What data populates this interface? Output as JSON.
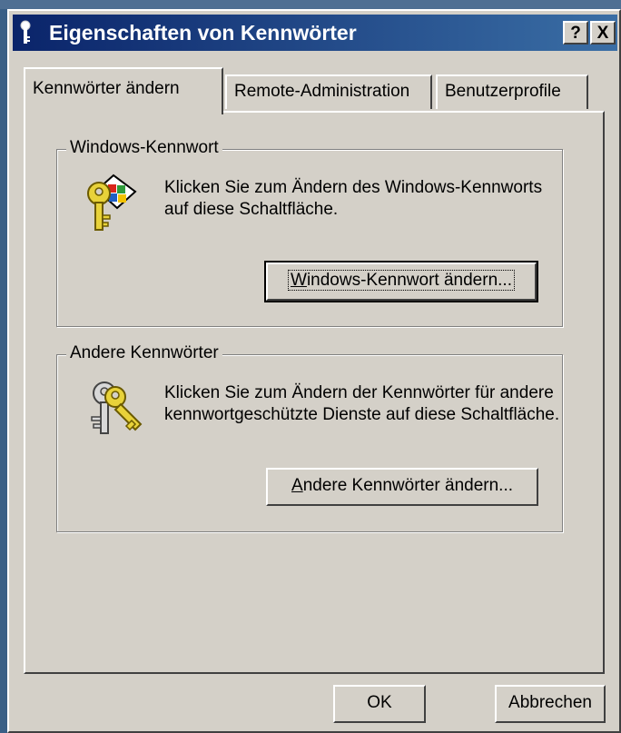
{
  "window": {
    "title": "Eigenschaften von Kennwörter",
    "help_label": "?",
    "close_label": "X"
  },
  "tabs": [
    {
      "label": "Kennwörter ändern",
      "active": true
    },
    {
      "label": "Remote-Administration",
      "active": false
    },
    {
      "label": "Benutzerprofile",
      "active": false
    }
  ],
  "windows_password": {
    "legend": "Windows-Kennwort",
    "description": "Klicken Sie zum Ändern des Windows-Kennworts auf diese Schaltfläche.",
    "button_accel": "W",
    "button_rest": "indows-Kennwort ändern..."
  },
  "other_passwords": {
    "legend": "Andere Kennwörter",
    "description": "Klicken Sie zum Ändern der Kennwörter für andere kennwortgeschützte Dienste auf diese Schaltfläche.",
    "button_accel": "A",
    "button_rest": "ndere Kennwörter ändern..."
  },
  "footer": {
    "ok_label": "OK",
    "cancel_label": "Abbrechen"
  },
  "icons": {
    "title": "key-icon",
    "windows_password": "windows-key-icon",
    "other_passwords": "keys-icon"
  },
  "colors": {
    "face": "#d4d0c8",
    "title_start": "#0a246a",
    "title_end": "#3a6ea5",
    "key_yellow": "#e8d23a"
  }
}
